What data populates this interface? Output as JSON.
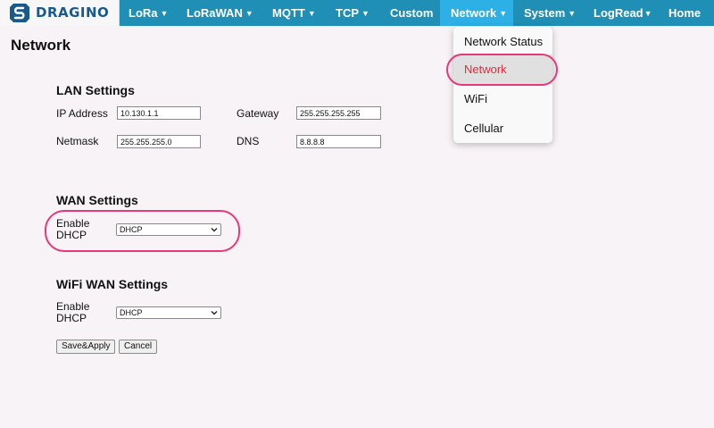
{
  "navbar": {
    "logo_text": "DRAGINO",
    "items": [
      {
        "label": "LoRa",
        "caret": "▼"
      },
      {
        "label": "LoRaWAN",
        "caret": "▼"
      },
      {
        "label": "MQTT",
        "caret": "▼"
      },
      {
        "label": "TCP",
        "caret": "▼"
      },
      {
        "label": "Custom",
        "caret": ""
      },
      {
        "label": "Network",
        "caret": "▼"
      },
      {
        "label": "System",
        "caret": "▼"
      },
      {
        "label": "LogRead",
        "caret": "▼"
      },
      {
        "label": "Home",
        "caret": ""
      }
    ],
    "active_item": "Network",
    "color": "#1f8fb6",
    "active_color": "#2cb0e6"
  },
  "dropdown": {
    "items": [
      "Network Status",
      "Network",
      "WiFi",
      "Cellular"
    ],
    "selected": "Network",
    "selected_color": "#e02a3a"
  },
  "page": {
    "title": "Network"
  },
  "lan": {
    "title": "LAN Settings",
    "ip_label": "IP Address",
    "ip_value": "10.130.1.1",
    "gateway_label": "Gateway",
    "gateway_value": "255.255.255.255",
    "netmask_label": "Netmask",
    "netmask_value": "255.255.255.0",
    "dns_label": "DNS",
    "dns_value": "8.8.8.8"
  },
  "wan": {
    "title": "WAN Settings",
    "dhcp_label_1": "Enable",
    "dhcp_label_2": "DHCP",
    "dhcp_value": "DHCP"
  },
  "wifi_wan": {
    "title": "WiFi WAN Settings",
    "dhcp_label_1": "Enable",
    "dhcp_label_2": "DHCP",
    "dhcp_value": "DHCP"
  },
  "buttons": {
    "save_label": "Save&Apply",
    "cancel_label": "Cancel"
  },
  "highlight_color": "#e6397a"
}
